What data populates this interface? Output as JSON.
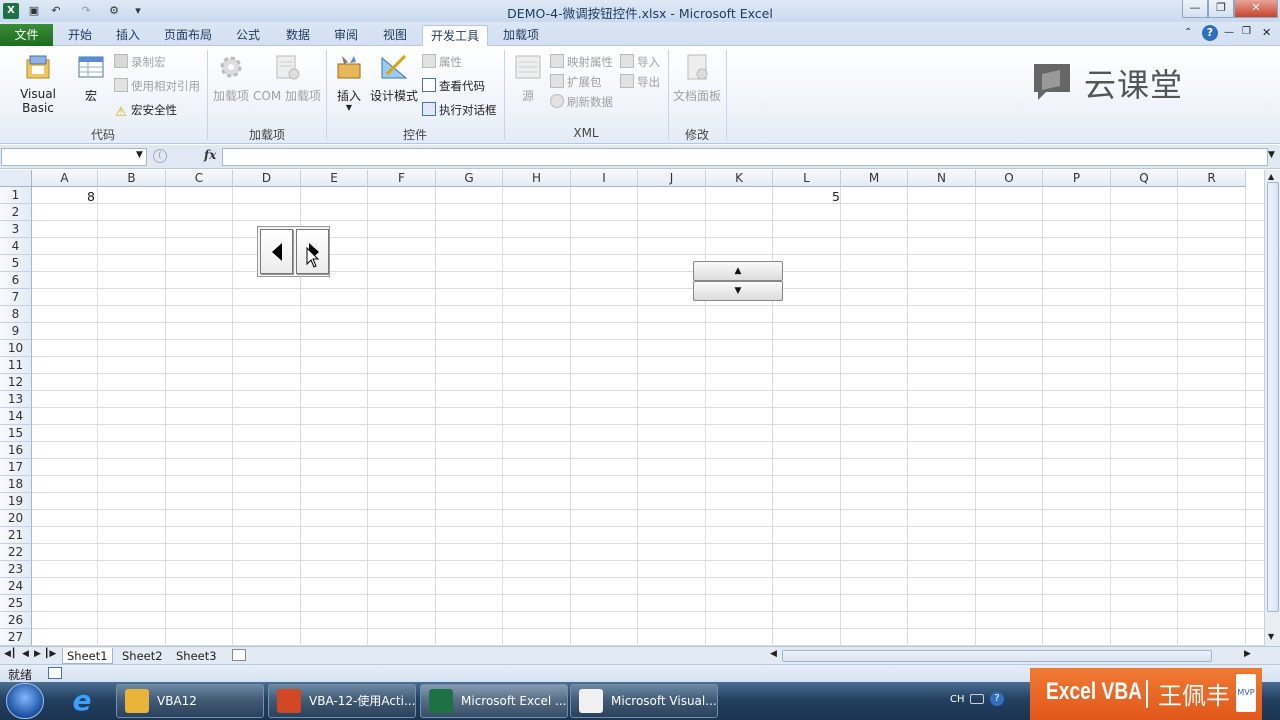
{
  "window": {
    "title": "DEMO-4-微调按钮控件.xlsx - Microsoft Excel"
  },
  "tabs": [
    "文件",
    "开始",
    "插入",
    "页面布局",
    "公式",
    "数据",
    "审阅",
    "视图",
    "开发工具",
    "加载项"
  ],
  "ribbon": {
    "code": {
      "label": "代码",
      "vb": "Visual Basic",
      "macro": "宏",
      "record": "录制宏",
      "relative": "使用相对引用",
      "security": "宏安全性"
    },
    "addins": {
      "label": "加载项",
      "addins": "加载项",
      "com": "COM 加载项"
    },
    "controls": {
      "label": "控件",
      "insert": "插入",
      "design": "设计模式",
      "properties": "属性",
      "viewcode": "查看代码",
      "dialog": "执行对话框"
    },
    "xml": {
      "label": "XML",
      "source": "源",
      "map": "映射属性",
      "expand": "扩展包",
      "refresh": "刷新数据",
      "import": "导入",
      "export": "导出"
    },
    "modify": {
      "label": "修改",
      "docpanel": "文档面板"
    }
  },
  "watermark": "云课堂",
  "formula": {
    "fx": "fx",
    "namebox": "",
    "content": ""
  },
  "columns": [
    "A",
    "B",
    "C",
    "D",
    "E",
    "F",
    "G",
    "H",
    "I",
    "J",
    "K",
    "L",
    "M",
    "N",
    "O",
    "P",
    "Q",
    "R"
  ],
  "rows": [
    "1",
    "2",
    "3",
    "4",
    "5",
    "6",
    "7",
    "8",
    "9",
    "10",
    "11",
    "12",
    "13",
    "14",
    "15",
    "16",
    "17",
    "18",
    "19",
    "20",
    "21",
    "22",
    "23",
    "24",
    "25",
    "26",
    "27"
  ],
  "cells": {
    "A1": "8",
    "L1": "5"
  },
  "sheets": [
    "Sheet1",
    "Sheet2",
    "Sheet3"
  ],
  "status": {
    "ready": "就绪"
  },
  "taskbar": {
    "items": [
      {
        "label": "VBA12",
        "color": "#e9b43a"
      },
      {
        "label": "VBA-12-使用Acti...",
        "color": "#d24726"
      },
      {
        "label": "Microsoft Excel ...",
        "color": "#1e7145"
      },
      {
        "label": "Microsoft Visual...",
        "color": "#f0f0f0"
      }
    ],
    "tray_lang": "CH"
  },
  "brand": {
    "left": "Excel VBA",
    "right": "王佩丰"
  }
}
